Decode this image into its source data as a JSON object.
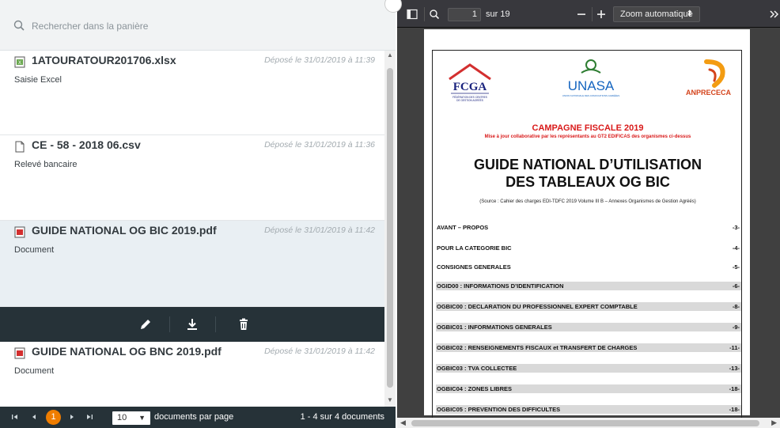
{
  "search": {
    "placeholder": "Rechercher dans la panière",
    "icon": "search-icon"
  },
  "files": [
    {
      "name": "1ATOURATOUR201706.xlsx",
      "date": "Déposé le 31/01/2019 à 11:39",
      "type": "Saisie Excel",
      "icon": "excel-file-icon"
    },
    {
      "name": "CE - 58 - 2018 06.csv",
      "date": "Déposé le 31/01/2019 à 11:36",
      "type": "Relevé bancaire",
      "icon": "file-icon"
    },
    {
      "name": "GUIDE NATIONAL OG BIC 2019.pdf",
      "date": "Déposé le 31/01/2019 à 11:42",
      "type": "Document",
      "icon": "pdf-file-icon",
      "selected": true
    },
    {
      "name": "GUIDE NATIONAL OG BNC 2019.pdf",
      "date": "Déposé le 31/01/2019 à 11:42",
      "type": "Document",
      "icon": "pdf-file-icon"
    }
  ],
  "actions": {
    "edit": "pencil-icon",
    "download": "download-icon",
    "delete": "trash-icon"
  },
  "pager": {
    "current_page": "1",
    "per_page": "10",
    "per_page_label": "documents par page",
    "count_label": "1 - 4 sur 4 documents"
  },
  "viewer": {
    "page_input": "1",
    "page_of": "sur 19",
    "zoom_label": "Zoom automatique",
    "minus": "—",
    "plus": "+"
  },
  "pdf": {
    "logo_fcga": "FCGA",
    "logo_fcga_sub": "FÉDÉRATION DES CENTRES DE GESTION AGRÉÉS",
    "logo_unasa": "UNASA",
    "logo_anprececa": "ANPRECECA",
    "campagne": "CAMPAGNE FISCALE 2019",
    "maj": "Mise à jour collaborative par les représentants au GT2 EDIFICAS des organismes ci-dessus",
    "title_line1": "GUIDE NATIONAL D’UTILISATION",
    "title_line2": "DES TABLEAUX OG BIC",
    "source": "(Source : Cahier des charges EDI-TDFC 2019 Volume III B – Annexes Organismes de Gestion Agréés)",
    "toc": [
      {
        "label": "AVANT – PROPOS",
        "page": "-3-",
        "shaded": false
      },
      {
        "label": "POUR LA CATEGORIE BIC",
        "page": "-4-",
        "shaded": false
      },
      {
        "label": "CONSIGNES GENERALES",
        "page": "-5-",
        "shaded": false
      },
      {
        "label": "OGID00   : INFORMATIONS D’IDENTIFICATION",
        "page": "-6-",
        "shaded": true
      },
      {
        "label": "OGBIC00 : DECLARATION DU PROFESSIONNEL EXPERT COMPTABLE",
        "page": "-8-",
        "shaded": true
      },
      {
        "label": "OGBIC01 : INFORMATIONS GENERALES",
        "page": "-9-",
        "shaded": true
      },
      {
        "label": "OGBIC02 : RENSEIGNEMENTS FISCAUX et TRANSFERT DE CHARGES",
        "page": "-11-",
        "shaded": true
      },
      {
        "label": "OGBIC03 : TVA COLLECTEE",
        "page": "-13-",
        "shaded": true
      },
      {
        "label": "OGBIC04 : ZONES LIBRES",
        "page": "-18-",
        "shaded": true
      },
      {
        "label": "OGBIC05 : PREVENTION DES DIFFICULTES",
        "page": "-18-",
        "shaded": true
      }
    ]
  },
  "colors": {
    "accent": "#ef7d00",
    "dark": "#263238",
    "selected_bg": "#e9eff3",
    "pdf_red": "#d91a1a"
  }
}
